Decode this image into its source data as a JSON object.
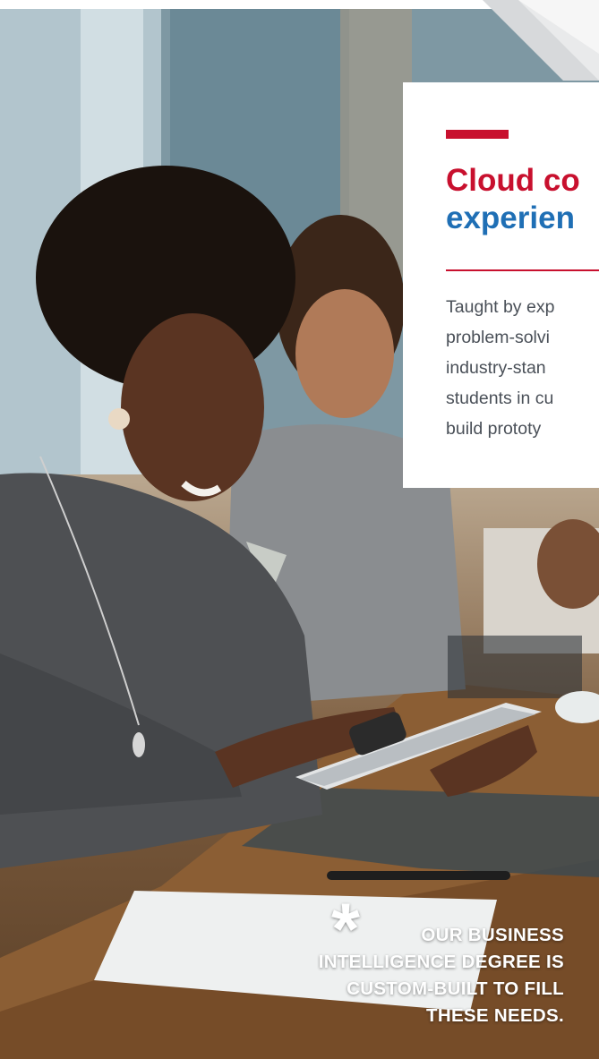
{
  "card": {
    "title_line1": "Cloud co",
    "title_line2": "experien",
    "body_lines": [
      "Taught by exp",
      "problem-solvi",
      "industry-stan",
      "students in cu",
      "build prototy"
    ]
  },
  "callout": {
    "symbol": "*",
    "lines": [
      "OUR BUSINESS",
      "INTELLIGENCE DEGREE IS",
      "CUSTOM-BUILT TO FILL",
      "THESE NEEDS."
    ]
  },
  "colors": {
    "accent_red": "#c8102e",
    "title_blue": "#1f6fb5",
    "body_gray": "#4a5058"
  }
}
